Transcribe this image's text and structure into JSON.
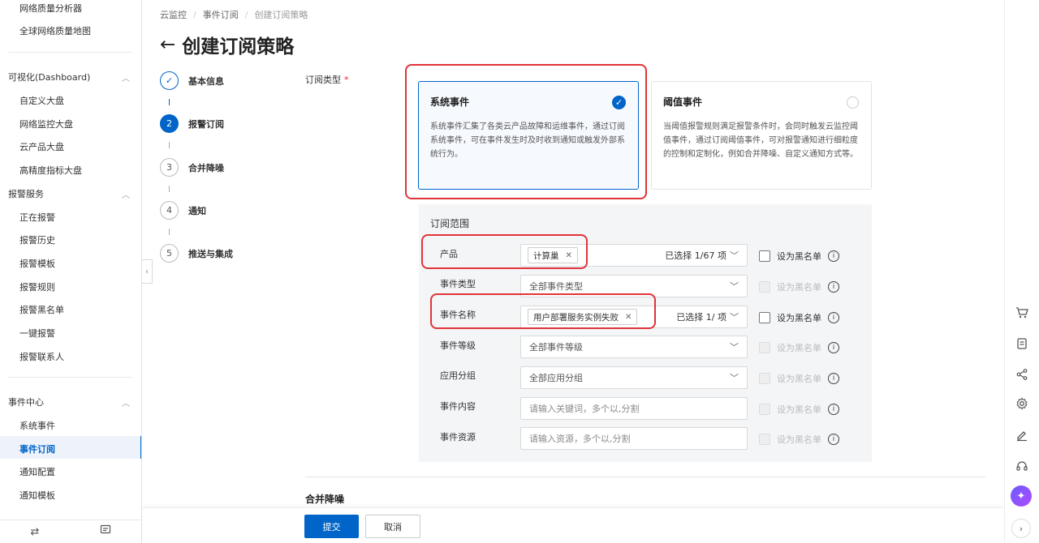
{
  "sidebar": {
    "items_top": [
      "网络质量分析器",
      "全球网络质量地图"
    ],
    "groups": [
      {
        "label": "可视化(Dashboard)",
        "items": [
          "自定义大盘",
          "网络监控大盘",
          "云产品大盘",
          "高精度指标大盘"
        ]
      },
      {
        "label": "报警服务",
        "items": [
          "正在报警",
          "报警历史",
          "报警模板",
          "报警规则",
          "报警黑名单",
          "一键报警",
          "报警联系人"
        ]
      },
      {
        "label": "事件中心",
        "items": [
          "系统事件",
          "事件订阅",
          "通知配置",
          "通知模板"
        ]
      }
    ],
    "active_item": "事件订阅",
    "footer_icons": [
      "swap-icon",
      "message-icon"
    ]
  },
  "breadcrumb": [
    "云监控",
    "事件订阅",
    "创建订阅策略"
  ],
  "page_title": "创建订阅策略",
  "steps": [
    {
      "label": "基本信息",
      "state": "done"
    },
    {
      "number": "2",
      "label": "报警订阅",
      "state": "active"
    },
    {
      "number": "3",
      "label": "合并降噪",
      "state": "pending"
    },
    {
      "number": "4",
      "label": "通知",
      "state": "pending"
    },
    {
      "number": "5",
      "label": "推送与集成",
      "state": "pending"
    }
  ],
  "subscription_type": {
    "label": "订阅类型",
    "required_mark": "*",
    "options": [
      {
        "title": "系统事件",
        "desc": "系统事件汇集了各类云产品故障和运维事件，通过订阅系统事件，可在事件发生时及时收到通知或触发外部系统行为。",
        "selected": true
      },
      {
        "title": "阈值事件",
        "desc": "当阈值报警规则满足报警条件时，会同时触发云监控阈值事件，通过订阅阈值事件，可对报警通知进行细粒度的控制和定制化，例如合并降噪、自定义通知方式等。",
        "selected": false
      }
    ]
  },
  "scope": {
    "title": "订阅范围",
    "blacklist_label": "设为黑名单",
    "fields": {
      "product": {
        "label": "产品",
        "tag": "计算巢",
        "count": "已选择 1/67 项"
      },
      "event_type": {
        "label": "事件类型",
        "placeholder": "全部事件类型"
      },
      "event_name": {
        "label": "事件名称",
        "tag": "用户部署服务实例失败",
        "count": "已选择 1/ 项"
      },
      "event_level": {
        "label": "事件等级",
        "placeholder": "全部事件等级"
      },
      "app_group": {
        "label": "应用分组",
        "placeholder": "全部应用分组"
      },
      "event_content": {
        "label": "事件内容",
        "placeholder": "请输入关键词，多个以,分割"
      },
      "event_resource": {
        "label": "事件资源",
        "placeholder": "请输入资源，多个以,分割"
      }
    }
  },
  "merge_section_title": "合并降噪",
  "footer": {
    "submit": "提交",
    "cancel": "取消"
  },
  "colors": {
    "primary": "#0064c8",
    "highlight": "#e0343a"
  }
}
